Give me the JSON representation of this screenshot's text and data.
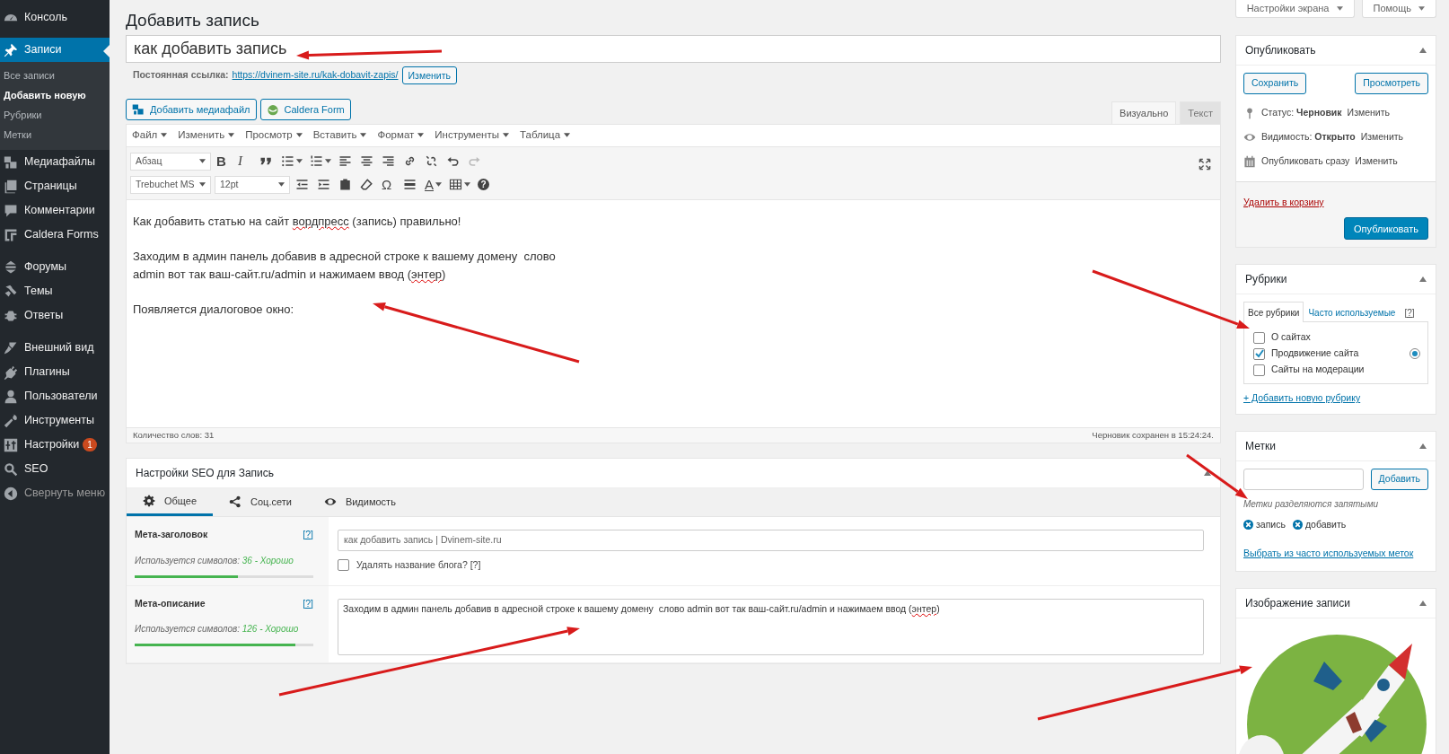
{
  "sidebar": {
    "groups": [
      [
        {
          "label": "Консоль",
          "selected": false
        }
      ],
      [
        {
          "label": "Записи",
          "selected": true,
          "children": [
            {
              "label": "Все записи",
              "selected": false
            },
            {
              "label": "Добавить новую",
              "selected": true
            },
            {
              "label": "Рубрики",
              "selected": false
            },
            {
              "label": "Метки",
              "selected": false
            }
          ]
        },
        {
          "label": "Медиафайлы",
          "selected": false
        },
        {
          "label": "Страницы",
          "selected": false
        },
        {
          "label": "Комментарии",
          "selected": false
        },
        {
          "label": "Caldera Forms",
          "selected": false
        }
      ],
      [
        {
          "label": "Форумы",
          "selected": false
        },
        {
          "label": "Темы",
          "selected": false
        },
        {
          "label": "Ответы",
          "selected": false
        }
      ],
      [
        {
          "label": "Внешний вид",
          "selected": false
        },
        {
          "label": "Плагины",
          "selected": false
        },
        {
          "label": "Пользователи",
          "selected": false
        },
        {
          "label": "Инструменты",
          "selected": false
        },
        {
          "label": "Настройки",
          "selected": false,
          "badge": "1"
        },
        {
          "label": "SEO",
          "selected": false
        },
        {
          "label": "Свернуть меню",
          "selected": false
        }
      ]
    ]
  },
  "screen_buttons": [
    "Настройки экрана",
    "Помощь"
  ],
  "page_title": "Добавить запись",
  "post_title": "как добавить запись",
  "permalink": {
    "label": "Постоянная ссылка:",
    "url": "https://dvinem-site.ru/kak-dobavit-zapis/",
    "button": "Изменить"
  },
  "media_buttons": [
    "Добавить медиафайл",
    "Caldera Form"
  ],
  "editor_tabs": [
    {
      "label": "Визуально",
      "selected": true
    },
    {
      "label": "Текст",
      "selected": false
    }
  ],
  "menu_bar": [
    "Файл",
    "Изменить",
    "Просмотр",
    "Вставить",
    "Формат",
    "Инструменты",
    "Таблица"
  ],
  "toolbar": [
    [
      {
        "kind": "select",
        "value": "Абзац"
      },
      {
        "kind": "bold",
        "glyph": "B"
      },
      {
        "kind": "italic",
        "glyph": "I"
      },
      {
        "kind": "button"
      },
      {
        "kind": "button",
        "dropdown": true
      },
      {
        "kind": "button",
        "dropdown": true
      },
      {
        "kind": "button"
      },
      {
        "kind": "button"
      },
      {
        "kind": "button"
      },
      {
        "kind": "button"
      },
      {
        "kind": "button"
      },
      {
        "kind": "button"
      },
      {
        "kind": "button",
        "disabled": true
      }
    ],
    [
      {
        "kind": "select",
        "value": "Trebuchet MS"
      },
      {
        "kind": "wideselect",
        "value": "12pt"
      },
      {
        "kind": "button"
      },
      {
        "kind": "button"
      },
      {
        "kind": "button"
      },
      {
        "kind": "button"
      },
      {
        "kind": "glyph",
        "glyph": "Ω"
      },
      {
        "kind": "button"
      },
      {
        "kind": "textcolor",
        "glyph": "A",
        "dropdown": true
      },
      {
        "kind": "button",
        "dropdown": true
      },
      {
        "kind": "help",
        "glyph": "?"
      }
    ]
  ],
  "content": [
    [
      [
        {
          "text": "Как добавить статью на сайт "
        },
        {
          "text": "вордпресс",
          "misspelled": true
        },
        {
          "text": " (запись) правильно!"
        }
      ]
    ],
    [
      [
        {
          "text": "Заходим в админ панель добавив в адресной строке к вашему домену  слово"
        }
      ],
      [
        {
          "text": "admin вот так ваш-сайт.ru/admin и нажимаем ввод ("
        },
        {
          "text": "энтер",
          "misspelled": true
        },
        {
          "text": ")"
        }
      ]
    ],
    [
      [
        {
          "text": "Появляется диалоговое окно:"
        }
      ]
    ]
  ],
  "status_bar": {
    "word_count": "Количество слов: 31",
    "draft_saved": "Черновик сохранен в 15:24:24."
  },
  "seo": {
    "title": "Настройки SEO для Запись",
    "tabs": [
      {
        "label": "Общее",
        "selected": true
      },
      {
        "label": "Соц.сети",
        "selected": false
      },
      {
        "label": "Видимость",
        "selected": false
      }
    ],
    "fields": [
      {
        "kind": "input",
        "label": "Мета-заголовок",
        "help": "[?]",
        "usage_label": "Используется символов:",
        "usage_value": "36 - Хорошо",
        "level": 0.58,
        "value": [
          {
            "text": "как добавить запись | Dvinem-site.ru"
          }
        ],
        "checkbox": {
          "label": "Удалять название блога? [?]",
          "checked": false
        }
      },
      {
        "kind": "textarea",
        "label": "Мета-описание",
        "help": "[?]",
        "usage_label": "Используется символов:",
        "usage_value": "126 - Хорошо",
        "level": 0.9,
        "value": [
          {
            "text": "Заходим в админ панель добавив в адресной строке к вашему домену  слово admin вот так ваш-сайт.ru/admin и нажимаем ввод ("
          },
          {
            "text": "энтер",
            "misspelled": true
          },
          {
            "text": ")"
          }
        ]
      }
    ]
  },
  "publish": {
    "title": "Опубликовать",
    "save": "Сохранить",
    "preview": "Просмотреть",
    "rows": [
      {
        "text": "Статус: **Черновик**",
        "link": "Изменить"
      },
      {
        "text": "Видимость: **Открыто**",
        "link": "Изменить"
      },
      {
        "text": "Опубликовать сразу",
        "link": "Изменить"
      }
    ],
    "trash": "Удалить в корзину",
    "publish_button": "Опубликовать"
  },
  "categories": {
    "title": "Рубрики",
    "tabs": [
      {
        "label": "Все рубрики",
        "selected": true
      },
      {
        "label": "Часто используемые",
        "selected": false
      }
    ],
    "help": "[?]",
    "items": [
      {
        "label": "О сайтах",
        "checked": false,
        "primary": false
      },
      {
        "label": "Продвижение сайта",
        "checked": true,
        "primary": true
      },
      {
        "label": "Сайты на модерации",
        "checked": false,
        "primary": false
      }
    ],
    "add_link": "+ Добавить новую рубрику"
  },
  "tags": {
    "title": "Метки",
    "button": "Добавить",
    "hint": "Метки разделяются запятыми",
    "items": [
      "запись",
      "добавить"
    ],
    "link": "Выбрать из часто используемых меток"
  },
  "featured_image": {
    "title": "Изображение записи",
    "kind": "picture"
  }
}
